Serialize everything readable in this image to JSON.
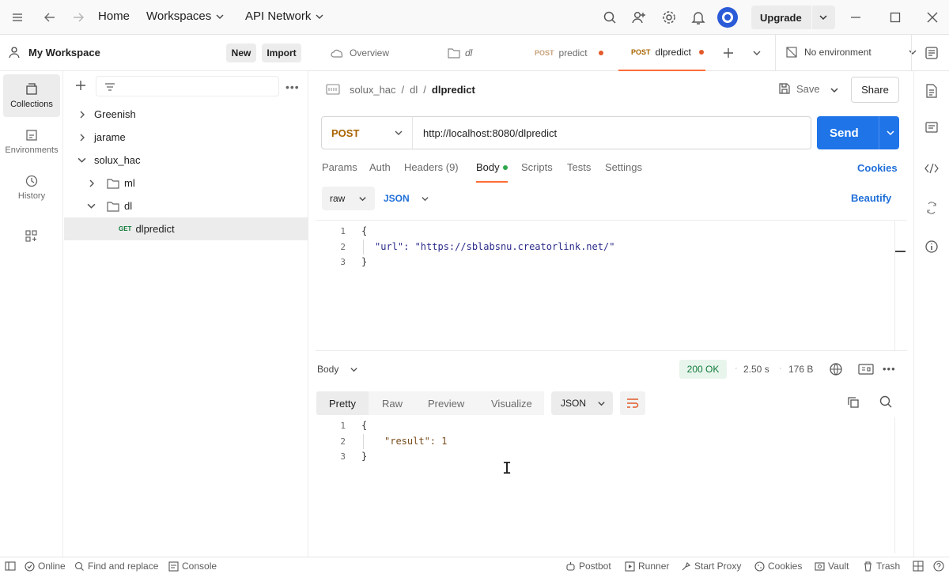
{
  "topbar": {
    "home_label": "Home",
    "workspaces_label": "Workspaces",
    "api_network_label": "API Network",
    "upgrade_label": "Upgrade"
  },
  "workspace": {
    "name": "My Workspace",
    "new_label": "New",
    "import_label": "Import"
  },
  "leftnav": [
    {
      "label": "Collections",
      "icon": "collections-icon"
    },
    {
      "label": "Environments",
      "icon": "environments-icon"
    },
    {
      "label": "History",
      "icon": "history-icon"
    }
  ],
  "tree": {
    "items": [
      {
        "label": "Greenish"
      },
      {
        "label": "jarame"
      },
      {
        "label": "solux_hac"
      },
      {
        "label": "ml"
      },
      {
        "label": "dl"
      },
      {
        "label": "dlpredict",
        "method": "GET"
      }
    ]
  },
  "tabs": {
    "overview": "Overview",
    "dl": "dl",
    "tab1_method": "POST",
    "tab1_label": "predict",
    "tab2_method": "POST",
    "tab2_label": "dlpredict",
    "environment": "No environment"
  },
  "request": {
    "breadcrumb": [
      "solux_hac",
      "/",
      "dl",
      "/",
      "dlpredict"
    ],
    "save_label": "Save",
    "share_label": "Share",
    "method": "POST",
    "url": "http://localhost:8080/dlpredict",
    "send_label": "Send",
    "tabs": [
      "Params",
      "Auth",
      "Headers (9)",
      "Body",
      "Scripts",
      "Tests",
      "Settings"
    ],
    "cookies_label": "Cookies",
    "body_mode": "raw",
    "body_format": "JSON",
    "beautify_label": "Beautify",
    "body_lines": [
      "{",
      "\"url\": \"https://sblabsnu.creatorlink.net/\"",
      "}"
    ],
    "line_numbers": [
      "1",
      "2",
      "3"
    ]
  },
  "response": {
    "body_label": "Body",
    "status": "200 OK",
    "time": "2.50 s",
    "size": "176 B",
    "view_tabs": [
      "Pretty",
      "Raw",
      "Preview",
      "Visualize"
    ],
    "format": "JSON",
    "lines": [
      "{",
      "\"result\": 1",
      "}"
    ],
    "line_numbers": [
      "1",
      "2",
      "3"
    ]
  },
  "statusbar": {
    "online": "Online",
    "find_replace": "Find and replace",
    "console": "Console",
    "postbot": "Postbot",
    "runner": "Runner",
    "start_proxy": "Start Proxy",
    "cookies": "Cookies",
    "vault": "Vault",
    "trash": "Trash"
  },
  "colors": {
    "accent_orange": "#ff6c37",
    "send_blue": "#1f74e8",
    "status_green": "#0f7b3a"
  }
}
